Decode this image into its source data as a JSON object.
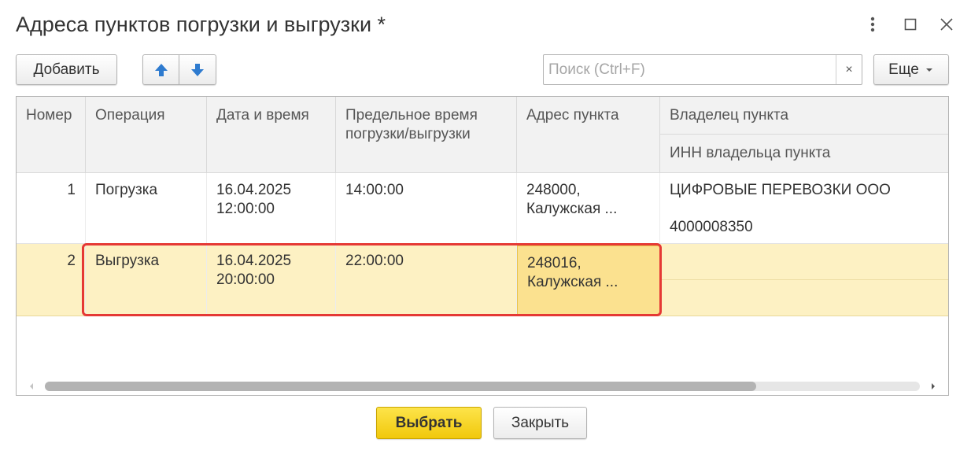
{
  "window": {
    "title": "Адреса пунктов погрузки и выгрузки *",
    "more_icon": "vertical-dots-icon",
    "maximize_icon": "square-icon",
    "close_icon": "close-icon"
  },
  "toolbar": {
    "add_label": "Добавить",
    "up_icon": "arrow-up-icon",
    "down_icon": "arrow-down-icon",
    "search_placeholder": "Поиск (Ctrl+F)",
    "search_value": "",
    "search_clear": "×",
    "more_label": "Еще",
    "accent": "#2e7bcf"
  },
  "table": {
    "headers": {
      "number": "Номер",
      "operation": "Операция",
      "datetime": "Дата и время",
      "deadline_line1": "Предельное время",
      "deadline_line2": "погрузки/выгрузки",
      "address": "Адрес пункта",
      "owner": "Владелец пункта",
      "owner_inn": "ИНН владельца пункта"
    },
    "rows": [
      {
        "number": "1",
        "operation": "Погрузка",
        "date": "16.04.2025",
        "time": "12:00:00",
        "deadline": "14:00:00",
        "address_line1": "248000,",
        "address_line2": "Калужская ...",
        "owner": "ЦИФРОВЫЕ ПЕРЕВОЗКИ ООО",
        "owner_inn": "4000008350"
      },
      {
        "number": "2",
        "operation": "Выгрузка",
        "date": "16.04.2025",
        "time": "20:00:00",
        "deadline": "22:00:00",
        "address_line1": "248016,",
        "address_line2": "Калужская ...",
        "owner": "",
        "owner_inn": ""
      }
    ],
    "selected_row_color": "#fdf1c3",
    "selected_cell_color": "#fbe18f",
    "highlight_color": "#e53935"
  },
  "footer": {
    "select_label": "Выбрать",
    "close_label": "Закрыть",
    "select_color": "#f5d01a"
  }
}
